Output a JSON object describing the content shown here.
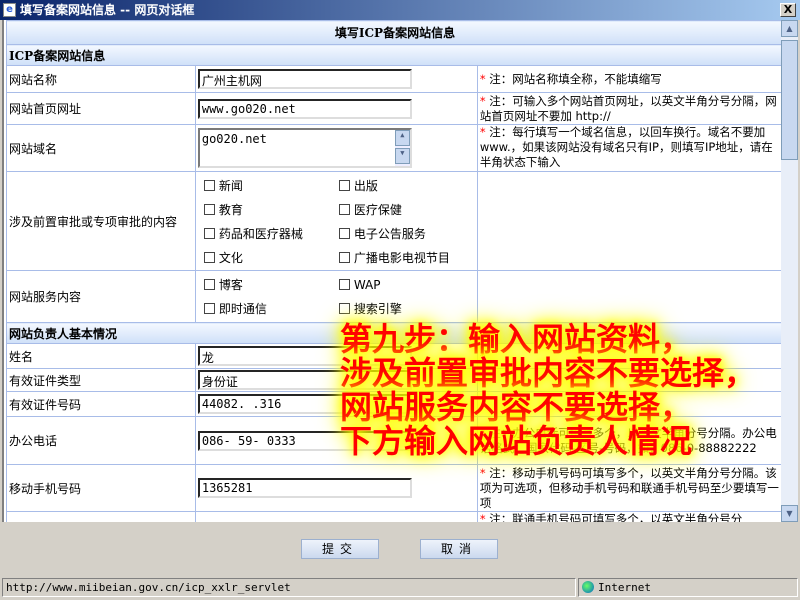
{
  "window": {
    "title": "填写备案网站信息 -- 网页对话框",
    "close": "X"
  },
  "form": {
    "title": "填写ICP备案网站信息",
    "section1": "ICP备案网站信息",
    "site_name": {
      "label": "网站名称",
      "value": "广州主机网",
      "note": "注：网站名称填全称，不能填缩写"
    },
    "site_url": {
      "label": "网站首页网址",
      "value": "www.go020.net",
      "note": "注：可输入多个网站首页网址，以英文半角分号分隔，网站首页网址不要加 http://"
    },
    "domain": {
      "label": "网站域名",
      "value": "go020.net",
      "note": "注：每行填写一个域名信息，以回车换行。域名不要加 www.，如果该网站没有域名只有IP，则填写IP地址，请在半角状态下输入"
    },
    "preapproval": {
      "label": "涉及前置审批或专项审批的内容",
      "options": [
        "新闻",
        "出版",
        "教育",
        "医疗保健",
        "药品和医疗器械",
        "电子公告服务",
        "文化",
        "广播电影电视节目"
      ]
    },
    "service": {
      "label": "网站服务内容",
      "options": [
        "博客",
        "WAP",
        "即时通信",
        "搜索引擎"
      ]
    },
    "section2": "网站负责人基本情况",
    "name": {
      "label": "姓名",
      "value": "龙"
    },
    "id_type": {
      "label": "有效证件类型",
      "value": "身份证"
    },
    "id_number": {
      "label": "有效证件号码",
      "value": "44082.        .316"
    },
    "office_phone": {
      "label": "办公电话",
      "value": "086-   59-    0333",
      "note": "注：办公电话可填写多个，以英文半角分号分隔。办公电话格式：国家代码-区号-号码，如：086-0-88882222"
    },
    "mobile": {
      "label": "移动手机号码",
      "value": "1365281",
      "note": "注：移动手机号码可填写多个，以英文半角分号分隔。该项为可选项，但移动手机号码和联通手机号码至少要填写一项"
    },
    "unicom_note": "注：联通手机号码可填写多个，以英文半角分号分"
  },
  "buttons": {
    "submit": "提交",
    "cancel": "取消"
  },
  "status": {
    "url": "http://www.miibeian.gov.cn/icp_xxlr_servlet",
    "zone": "Internet"
  },
  "overlay": [
    "第九步：输入网站资料，",
    "涉及前置审批内容不要选择，",
    "网站服务内容不要选择，",
    "下方输入网站负责人情况"
  ],
  "colors": {
    "overlay_text": "#ff0000",
    "overlay_glow": "#ffff00",
    "title_bar": "#0a246a"
  }
}
